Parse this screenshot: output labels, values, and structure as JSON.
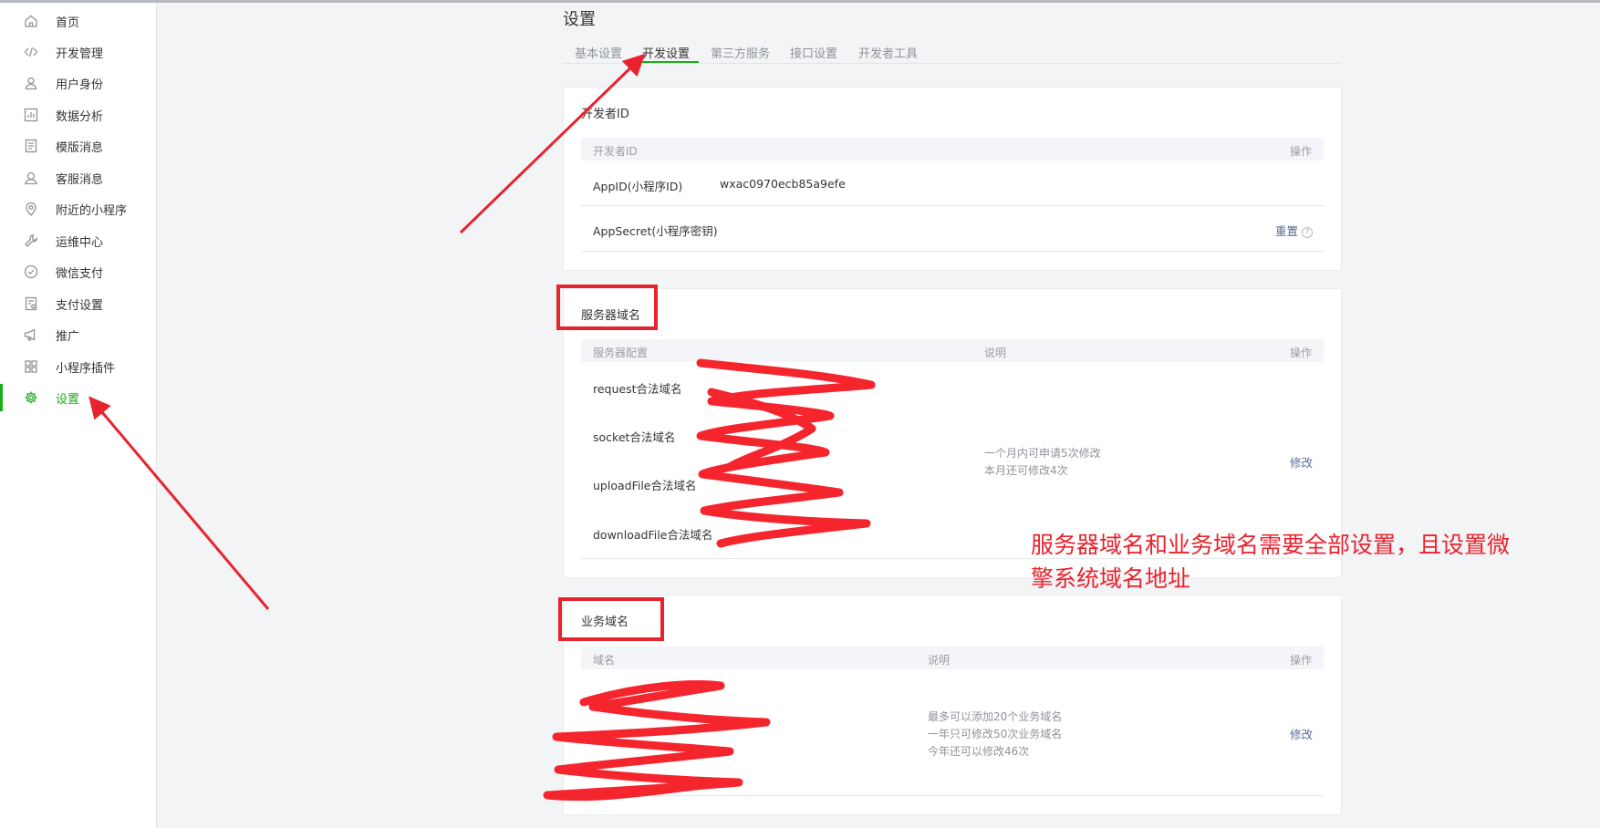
{
  "sidebar": {
    "items": [
      {
        "label": "首页",
        "icon": "home-icon"
      },
      {
        "label": "开发管理",
        "icon": "code-icon"
      },
      {
        "label": "用户身份",
        "icon": "user-icon"
      },
      {
        "label": "数据分析",
        "icon": "bar-chart-icon"
      },
      {
        "label": "模版消息",
        "icon": "document-icon"
      },
      {
        "label": "客服消息",
        "icon": "customer-service-icon"
      },
      {
        "label": "附近的小程序",
        "icon": "location-pin-icon"
      },
      {
        "label": "运维中心",
        "icon": "wrench-icon"
      },
      {
        "label": "微信支付",
        "icon": "check-circle-icon"
      },
      {
        "label": "支付设置",
        "icon": "payment-settings-icon"
      },
      {
        "label": "推广",
        "icon": "megaphone-icon"
      },
      {
        "label": "小程序插件",
        "icon": "grid-icon"
      },
      {
        "label": "设置",
        "icon": "gear-icon",
        "active": true
      }
    ]
  },
  "page": {
    "title": "设置",
    "tabs": [
      "基本设置",
      "开发设置",
      "第三方服务",
      "接口设置",
      "开发者工具"
    ],
    "active_tab": "开发设置"
  },
  "developer_id": {
    "title": "开发者ID",
    "header": {
      "col1": "开发者ID",
      "op": "操作"
    },
    "rows": [
      {
        "label": "AppID(小程序ID)",
        "value": "wxac0970ecb85a9efe"
      },
      {
        "label": "AppSecret(小程序密钥)",
        "action": "重置",
        "help": "?"
      }
    ]
  },
  "server_domain": {
    "title": "服务器域名",
    "header": {
      "col1": "服务器配置",
      "col2": "说明",
      "op": "操作"
    },
    "rows": [
      "request合法域名",
      "socket合法域名",
      "uploadFile合法域名",
      "downloadFile合法域名"
    ],
    "note_line1": "一个月内可申请5次修改",
    "note_line2": "本月还可修改4次",
    "action": "修改"
  },
  "business_domain": {
    "title": "业务域名",
    "header": {
      "col1": "域名",
      "col2": "说明",
      "op": "操作"
    },
    "note_line1": "最多可以添加20个业务域名",
    "note_line2": "一年只可修改50次业务域名",
    "note_line3": "今年还可以修改46次",
    "action": "修改"
  },
  "annotation": {
    "line1": "服务器域名和业务域名需要全部设置，且设置微",
    "line2": "擎系统域名地址",
    "color": "#e8232e"
  },
  "colors": {
    "accent": "#1aad19",
    "link": "#576b95",
    "annotation": "#e8232e"
  }
}
